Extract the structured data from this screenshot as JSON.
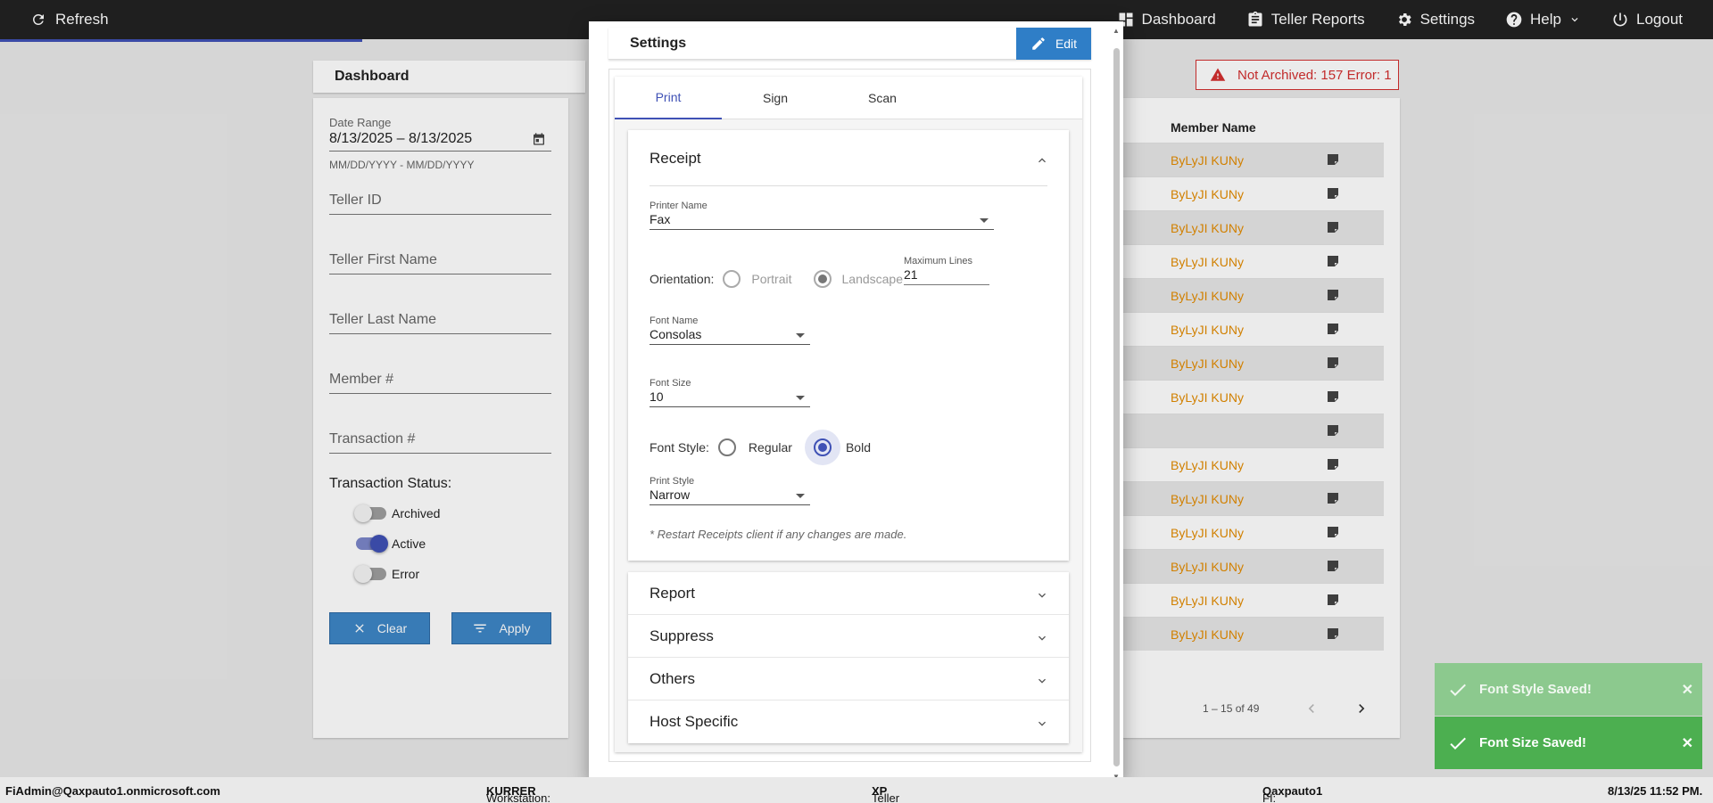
{
  "topbar": {
    "refresh_label": "Refresh",
    "nav": [
      {
        "label": "Dashboard",
        "icon": "dashboard-icon"
      },
      {
        "label": "Teller Reports",
        "icon": "clipboard-icon"
      },
      {
        "label": "Settings",
        "icon": "gear-icon"
      },
      {
        "label": "Help",
        "icon": "help-icon"
      },
      {
        "label": "Logout",
        "icon": "power-icon"
      }
    ]
  },
  "dashboard": {
    "title": "Dashboard",
    "filters": {
      "date_range_label": "Date Range",
      "date_range_value": "8/13/2025 – 8/13/2025",
      "date_range_hint": "MM/DD/YYYY - MM/DD/YYYY",
      "teller_id": "Teller ID",
      "teller_first_name": "Teller First Name",
      "teller_last_name": "Teller Last Name",
      "member_number": "Member #",
      "transaction_number": "Transaction #",
      "status_title": "Transaction Status:",
      "statuses": [
        {
          "label": "Archived",
          "on": false
        },
        {
          "label": "Active",
          "on": true
        },
        {
          "label": "Error",
          "on": false
        }
      ],
      "clear_label": "Clear",
      "apply_label": "Apply"
    },
    "alert": "Not Archived: 157  Error: 1",
    "table": {
      "column": "Member Name",
      "rows": [
        "ByLyJI KUNy",
        "ByLyJI KUNy",
        "ByLyJI KUNy",
        "ByLyJI KUNy",
        "ByLyJI KUNy",
        "ByLyJI KUNy",
        "ByLyJI KUNy",
        "ByLyJI KUNy",
        "",
        "ByLyJI KUNy",
        "ByLyJI KUNy",
        "ByLyJI KUNy",
        "ByLyJI KUNy",
        "ByLyJI KUNy",
        "ByLyJI KUNy"
      ]
    },
    "pager": "1 – 15 of 49"
  },
  "modal": {
    "title": "Settings",
    "edit_label": "Edit",
    "tabs": [
      "Print",
      "Sign",
      "Scan"
    ],
    "active_tab": "Print",
    "receipt": {
      "title": "Receipt",
      "printer_name_label": "Printer Name",
      "printer_name_value": "Fax",
      "orientation_label": "Orientation:",
      "orientation_portrait": "Portrait",
      "orientation_landscape": "Landscape",
      "max_lines_label": "Maximum Lines",
      "max_lines_value": "21",
      "font_name_label": "Font Name",
      "font_name_value": "Consolas",
      "font_size_label": "Font Size",
      "font_size_value": "10",
      "font_style_label": "Font Style:",
      "font_style_regular": "Regular",
      "font_style_bold": "Bold",
      "print_style_label": "Print Style",
      "print_style_value": "Narrow",
      "note": "* Restart Receipts client if any changes are made."
    },
    "sections": [
      "Report",
      "Suppress",
      "Others",
      "Host Specific"
    ]
  },
  "toasts": [
    {
      "text": "Font Style Saved!",
      "faded": true
    },
    {
      "text": "Font Size Saved!",
      "faded": false
    }
  ],
  "statusbar": {
    "user": "FiAdmin@Qaxpauto1.onmicrosoft.com",
    "workstation_label": "Workstation:",
    "workstation_value": "KURRER",
    "platform_label": "Teller Platform:",
    "platform_value": "XP",
    "fi_label": "FI:",
    "fi_value": "Qaxpauto1",
    "datetime": "8/13/25 11:52 PM."
  },
  "colors": {
    "accent": "#3f51b5",
    "button_blue": "#3d86c6",
    "link_orange": "#e38b00",
    "error_red": "#d32f2f",
    "success_green": "#4caf50"
  }
}
